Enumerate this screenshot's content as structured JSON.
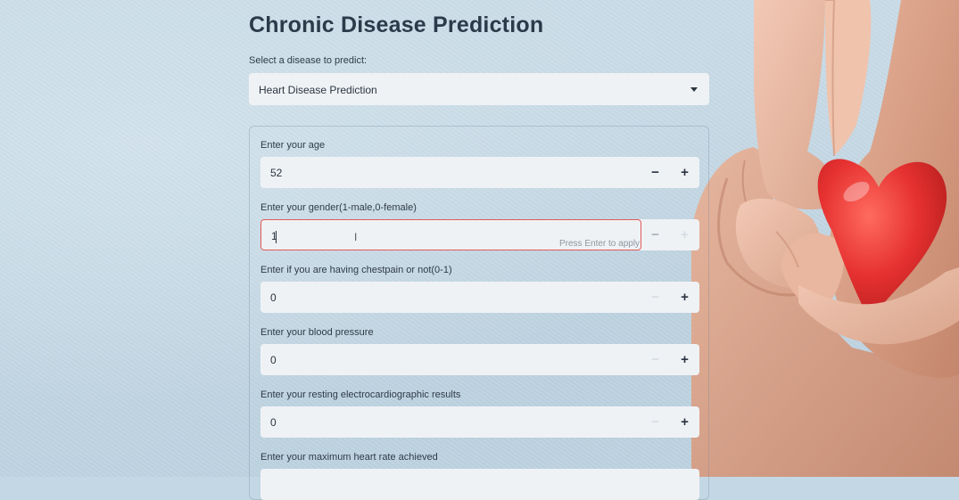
{
  "app": {
    "title": "Chronic Disease Prediction"
  },
  "selector": {
    "label": "Select a disease to predict:",
    "selected": "Heart Disease Prediction"
  },
  "form": {
    "fields": [
      {
        "label": "Enter your age",
        "value": "52"
      },
      {
        "label": "Enter your gender(1-male,0-female)",
        "value": "1",
        "hint": "Press Enter to apply"
      },
      {
        "label": "Enter if you are having chestpain or not(0-1)",
        "value": "0"
      },
      {
        "label": "Enter your blood pressure",
        "value": "0"
      },
      {
        "label": "Enter your resting electrocardiographic results",
        "value": "0"
      },
      {
        "label": "Enter your maximum heart rate achieved",
        "value": ""
      }
    ],
    "minus_symbol": "−",
    "plus_symbol": "+"
  },
  "colors": {
    "accent_focus": "#e25a5a",
    "heart": "#e53030",
    "input_bg": "#eff2f5",
    "text": "#2c3a4a"
  },
  "icons": {
    "dropdown": "chevron-down-icon",
    "decrement": "minus-icon",
    "increment": "plus-icon"
  }
}
